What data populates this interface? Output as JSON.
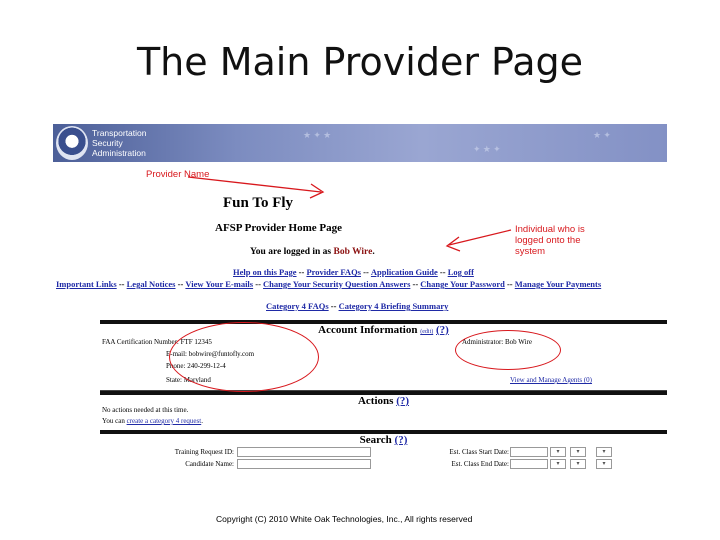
{
  "slide": {
    "title": "The Main Provider Page",
    "copyright": "Copyright (C) 2010 White Oak Technologies, Inc., All rights reserved"
  },
  "banner": {
    "org_line1": "Transportation",
    "org_line2": "Security",
    "org_line3": "Administration"
  },
  "header": {
    "provider_name": "Fun To Fly",
    "home_title": "AFSP Provider Home Page",
    "logged_in_prefix": "You are logged in as ",
    "user_name": "Bob Wire",
    "logged_in_suffix": "."
  },
  "annotations": {
    "provider": "Provider Name",
    "individual": "Individual who is logged onto the system"
  },
  "nav": {
    "row1": [
      "Help on this Page",
      "Provider FAQs",
      "Application Guide",
      "Log off"
    ],
    "row2": [
      "Important Links",
      "Legal Notices",
      "View Your E-mails",
      "Change Your Security Question Answers",
      "Change Your Password",
      "Manage Your Payments"
    ],
    "row3": [
      "Category 4 FAQs",
      "Category 4 Briefing Summary"
    ],
    "separator": "--"
  },
  "account": {
    "header": "Account Information",
    "edit_label": "(edit)",
    "help_label": "(?)",
    "cert_number": "FAA Certification Number: FTF 12345",
    "email": "E-mail: bobwire@funtofly.com",
    "phone": "Phone: 240-299-12-4",
    "state": "State: Maryland",
    "administrator": "Administrator: Bob Wire",
    "view_agents": "View and Manage Agents (0)"
  },
  "actions": {
    "header": "Actions",
    "help_label": "(?)",
    "none_needed": "No actions needed at this time.",
    "create_prefix": "You can ",
    "create_link": "create a category 4 request",
    "create_suffix": "."
  },
  "search": {
    "header": "Search",
    "help_label": "(?)",
    "training_label": "Training Request ID:",
    "candidate_label": "Candidate Name:",
    "start_label": "Est. Class Start Date:",
    "end_label": "Est. Class End Date:",
    "dropdown_glyph": "▾"
  },
  "colors": {
    "annotation_red": "#d8181d",
    "link_blue": "#1f2aa6",
    "banner_blue": "#4c5f98"
  }
}
